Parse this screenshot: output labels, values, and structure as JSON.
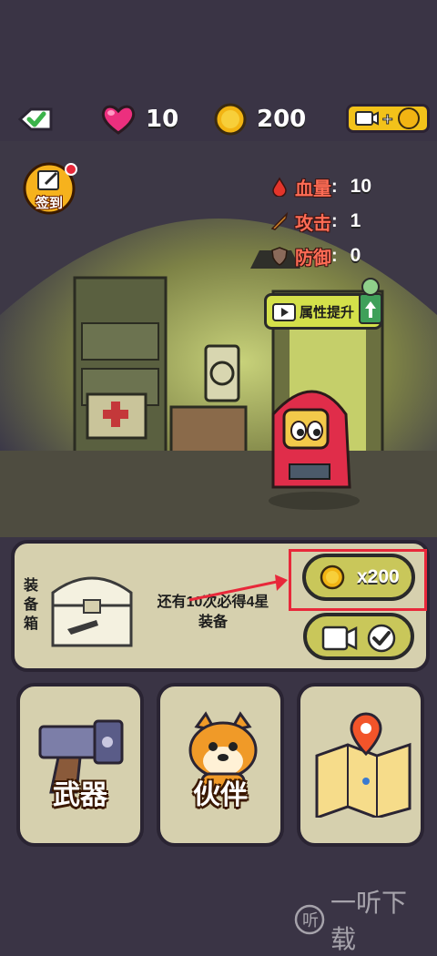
{
  "header": {
    "hearts": "10",
    "coins": "200"
  },
  "signin": {
    "label": "签到"
  },
  "attributes": [
    {
      "label": "血量",
      "value": "10",
      "icon": "blood-drop-icon",
      "color": "#e4352b"
    },
    {
      "label": "攻击",
      "value": "1",
      "icon": "sword-icon",
      "color": "#d98a2a"
    },
    {
      "label": "防御",
      "value": "0",
      "icon": "shield-icon",
      "color": "#8a6a5a"
    }
  ],
  "upgrade": {
    "label": "属性提升"
  },
  "chest": {
    "label": "装备箱",
    "info": "还有10次必得4星装备",
    "price": "x200"
  },
  "tiles": [
    {
      "label": "武器",
      "icon": "gun-icon"
    },
    {
      "label": "伙伴",
      "icon": "dog-icon"
    },
    {
      "label": "",
      "icon": "map-icon"
    }
  ],
  "watermark": "一听下载",
  "colors": {
    "accent_gold": "#f2c21a",
    "panel": "#d6d0ae",
    "highlight": "#e8283a",
    "attr_label": "#ff6c55"
  }
}
